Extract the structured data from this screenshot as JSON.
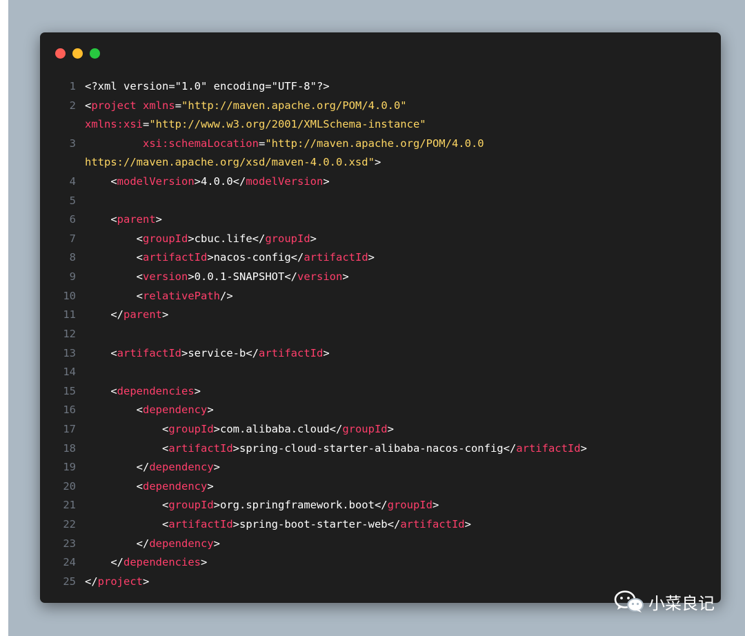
{
  "window_controls": {
    "close_color": "#ff5f57",
    "minimize_color": "#ffbd2e",
    "maximize_color": "#28c840"
  },
  "code": {
    "lines": [
      {
        "n": "1",
        "tokens": [
          {
            "t": "<?xml version=\"1.0\" encoding=\"UTF-8\"?>",
            "c": "punct"
          }
        ]
      },
      {
        "n": "2",
        "tokens": [
          {
            "t": "<",
            "c": "punct"
          },
          {
            "t": "project",
            "c": "tag"
          },
          {
            "t": " ",
            "c": "punct"
          },
          {
            "t": "xmlns",
            "c": "attr"
          },
          {
            "t": "=",
            "c": "punct"
          },
          {
            "t": "\"http://maven.apache.org/POM/4.0.0\"",
            "c": "str"
          }
        ]
      },
      {
        "n": "",
        "tokens": [
          {
            "t": "xmlns:xsi",
            "c": "attr"
          },
          {
            "t": "=",
            "c": "punct"
          },
          {
            "t": "\"http://www.w3.org/2001/XMLSchema-instance\"",
            "c": "str"
          }
        ]
      },
      {
        "n": "3",
        "tokens": [
          {
            "t": "         ",
            "c": "punct"
          },
          {
            "t": "xsi:schemaLocation",
            "c": "attr"
          },
          {
            "t": "=",
            "c": "punct"
          },
          {
            "t": "\"http://maven.apache.org/POM/4.0.0",
            "c": "str"
          }
        ]
      },
      {
        "n": "",
        "tokens": [
          {
            "t": "https://maven.apache.org/xsd/maven-4.0.0.xsd\"",
            "c": "str"
          },
          {
            "t": ">",
            "c": "punct"
          }
        ]
      },
      {
        "n": "4",
        "tokens": [
          {
            "t": "    <",
            "c": "punct"
          },
          {
            "t": "modelVersion",
            "c": "tag"
          },
          {
            "t": ">",
            "c": "punct"
          },
          {
            "t": "4.0.0",
            "c": "text"
          },
          {
            "t": "</",
            "c": "punct"
          },
          {
            "t": "modelVersion",
            "c": "tag"
          },
          {
            "t": ">",
            "c": "punct"
          }
        ]
      },
      {
        "n": "5",
        "tokens": []
      },
      {
        "n": "6",
        "tokens": [
          {
            "t": "    <",
            "c": "punct"
          },
          {
            "t": "parent",
            "c": "tag"
          },
          {
            "t": ">",
            "c": "punct"
          }
        ]
      },
      {
        "n": "7",
        "tokens": [
          {
            "t": "        <",
            "c": "punct"
          },
          {
            "t": "groupId",
            "c": "tag"
          },
          {
            "t": ">",
            "c": "punct"
          },
          {
            "t": "cbuc.life",
            "c": "text"
          },
          {
            "t": "</",
            "c": "punct"
          },
          {
            "t": "groupId",
            "c": "tag"
          },
          {
            "t": ">",
            "c": "punct"
          }
        ]
      },
      {
        "n": "8",
        "tokens": [
          {
            "t": "        <",
            "c": "punct"
          },
          {
            "t": "artifactId",
            "c": "tag"
          },
          {
            "t": ">",
            "c": "punct"
          },
          {
            "t": "nacos-config",
            "c": "text"
          },
          {
            "t": "</",
            "c": "punct"
          },
          {
            "t": "artifactId",
            "c": "tag"
          },
          {
            "t": ">",
            "c": "punct"
          }
        ]
      },
      {
        "n": "9",
        "tokens": [
          {
            "t": "        <",
            "c": "punct"
          },
          {
            "t": "version",
            "c": "tag"
          },
          {
            "t": ">",
            "c": "punct"
          },
          {
            "t": "0.0.1-SNAPSHOT",
            "c": "text"
          },
          {
            "t": "</",
            "c": "punct"
          },
          {
            "t": "version",
            "c": "tag"
          },
          {
            "t": ">",
            "c": "punct"
          }
        ]
      },
      {
        "n": "10",
        "tokens": [
          {
            "t": "        <",
            "c": "punct"
          },
          {
            "t": "relativePath",
            "c": "tag"
          },
          {
            "t": "/>",
            "c": "punct"
          }
        ]
      },
      {
        "n": "11",
        "tokens": [
          {
            "t": "    </",
            "c": "punct"
          },
          {
            "t": "parent",
            "c": "tag"
          },
          {
            "t": ">",
            "c": "punct"
          }
        ]
      },
      {
        "n": "12",
        "tokens": []
      },
      {
        "n": "13",
        "tokens": [
          {
            "t": "    <",
            "c": "punct"
          },
          {
            "t": "artifactId",
            "c": "tag"
          },
          {
            "t": ">",
            "c": "punct"
          },
          {
            "t": "service-b",
            "c": "text"
          },
          {
            "t": "</",
            "c": "punct"
          },
          {
            "t": "artifactId",
            "c": "tag"
          },
          {
            "t": ">",
            "c": "punct"
          }
        ]
      },
      {
        "n": "14",
        "tokens": []
      },
      {
        "n": "15",
        "tokens": [
          {
            "t": "    <",
            "c": "punct"
          },
          {
            "t": "dependencies",
            "c": "tag"
          },
          {
            "t": ">",
            "c": "punct"
          }
        ]
      },
      {
        "n": "16",
        "tokens": [
          {
            "t": "        <",
            "c": "punct"
          },
          {
            "t": "dependency",
            "c": "tag"
          },
          {
            "t": ">",
            "c": "punct"
          }
        ]
      },
      {
        "n": "17",
        "tokens": [
          {
            "t": "            <",
            "c": "punct"
          },
          {
            "t": "groupId",
            "c": "tag"
          },
          {
            "t": ">",
            "c": "punct"
          },
          {
            "t": "com.alibaba.cloud",
            "c": "text"
          },
          {
            "t": "</",
            "c": "punct"
          },
          {
            "t": "groupId",
            "c": "tag"
          },
          {
            "t": ">",
            "c": "punct"
          }
        ]
      },
      {
        "n": "18",
        "tokens": [
          {
            "t": "            <",
            "c": "punct"
          },
          {
            "t": "artifactId",
            "c": "tag"
          },
          {
            "t": ">",
            "c": "punct"
          },
          {
            "t": "spring-cloud-starter-alibaba-nacos-config",
            "c": "text"
          },
          {
            "t": "</",
            "c": "punct"
          },
          {
            "t": "artifactId",
            "c": "tag"
          },
          {
            "t": ">",
            "c": "punct"
          }
        ]
      },
      {
        "n": "19",
        "tokens": [
          {
            "t": "        </",
            "c": "punct"
          },
          {
            "t": "dependency",
            "c": "tag"
          },
          {
            "t": ">",
            "c": "punct"
          }
        ]
      },
      {
        "n": "20",
        "tokens": [
          {
            "t": "        <",
            "c": "punct"
          },
          {
            "t": "dependency",
            "c": "tag"
          },
          {
            "t": ">",
            "c": "punct"
          }
        ]
      },
      {
        "n": "21",
        "tokens": [
          {
            "t": "            <",
            "c": "punct"
          },
          {
            "t": "groupId",
            "c": "tag"
          },
          {
            "t": ">",
            "c": "punct"
          },
          {
            "t": "org.springframework.boot",
            "c": "text"
          },
          {
            "t": "</",
            "c": "punct"
          },
          {
            "t": "groupId",
            "c": "tag"
          },
          {
            "t": ">",
            "c": "punct"
          }
        ]
      },
      {
        "n": "22",
        "tokens": [
          {
            "t": "            <",
            "c": "punct"
          },
          {
            "t": "artifactId",
            "c": "tag"
          },
          {
            "t": ">",
            "c": "punct"
          },
          {
            "t": "spring-boot-starter-web",
            "c": "text"
          },
          {
            "t": "</",
            "c": "punct"
          },
          {
            "t": "artifactId",
            "c": "tag"
          },
          {
            "t": ">",
            "c": "punct"
          }
        ]
      },
      {
        "n": "23",
        "tokens": [
          {
            "t": "        </",
            "c": "punct"
          },
          {
            "t": "dependency",
            "c": "tag"
          },
          {
            "t": ">",
            "c": "punct"
          }
        ]
      },
      {
        "n": "24",
        "tokens": [
          {
            "t": "    </",
            "c": "punct"
          },
          {
            "t": "dependencies",
            "c": "tag"
          },
          {
            "t": ">",
            "c": "punct"
          }
        ]
      },
      {
        "n": "25",
        "tokens": [
          {
            "t": "</",
            "c": "punct"
          },
          {
            "t": "project",
            "c": "tag"
          },
          {
            "t": ">",
            "c": "punct"
          }
        ]
      }
    ]
  },
  "watermark": {
    "icon": "wechat-icon",
    "label": "小菜良记"
  }
}
